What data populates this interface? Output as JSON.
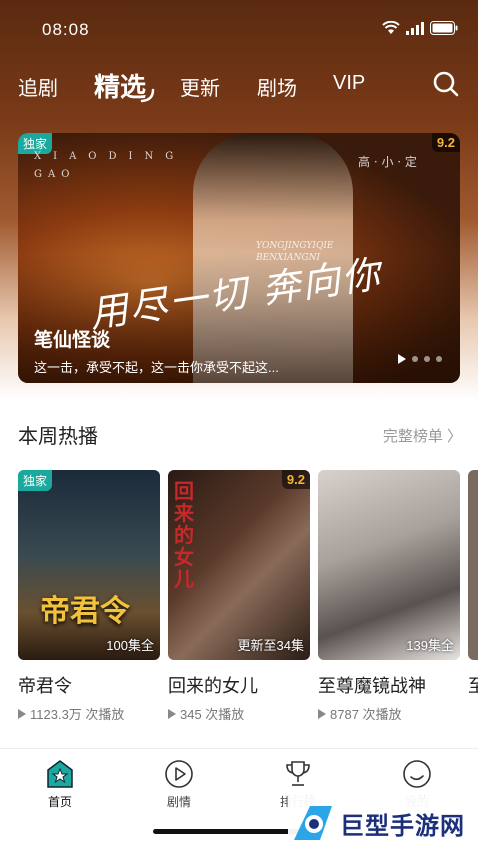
{
  "status_bar": {
    "time": "08:08"
  },
  "top_nav": {
    "tabs": [
      {
        "label": "追剧"
      },
      {
        "label": "精选"
      },
      {
        "label": "更新"
      },
      {
        "label": "剧场"
      },
      {
        "label": "VIP"
      }
    ],
    "active_tab": "精选"
  },
  "banner": {
    "badge": "独家",
    "rating": "9.2",
    "title": "笔仙怪谈",
    "description": "这一击，承受不起，这一击你承受不起这...",
    "deco_pinyin_top": "XIAODING",
    "deco_pinyin_gao": "GAO",
    "deco_credit": "高 · 小 · 定",
    "deco_slogan": "用尽一切 奔向你",
    "deco_pinyin_side": "YONGJINGYIQIE BENXIANGNI",
    "slide_count": 4
  },
  "section": {
    "title": "本周热播",
    "more_label": "完整榜单 〉"
  },
  "cards": [
    {
      "title": "帝君令",
      "badge": "独家",
      "poster_label": "100集全",
      "plays": "1123.3万 次播放",
      "poster_text": "帝君令"
    },
    {
      "title": "回来的女儿",
      "rating": "9.2",
      "poster_label": "更新至34集",
      "plays": "345 次播放",
      "poster_text": "回来的女儿"
    },
    {
      "title": "至尊魔镜战神",
      "poster_label": "139集全",
      "plays": "8787 次播放"
    },
    {
      "title": "至"
    }
  ],
  "bottom_nav": {
    "items": [
      {
        "label": "首页",
        "icon": "home-star-icon",
        "active": true
      },
      {
        "label": "剧情",
        "icon": "play-circle-icon"
      },
      {
        "label": "排行榜",
        "icon": "trophy-icon"
      },
      {
        "label": "我的",
        "icon": "profile-icon"
      }
    ]
  },
  "watermark": {
    "text": "巨型手游网"
  },
  "colors": {
    "accent": "#1aa99c",
    "rating": "#f3b53a",
    "watermark": "#1b2f7a"
  }
}
